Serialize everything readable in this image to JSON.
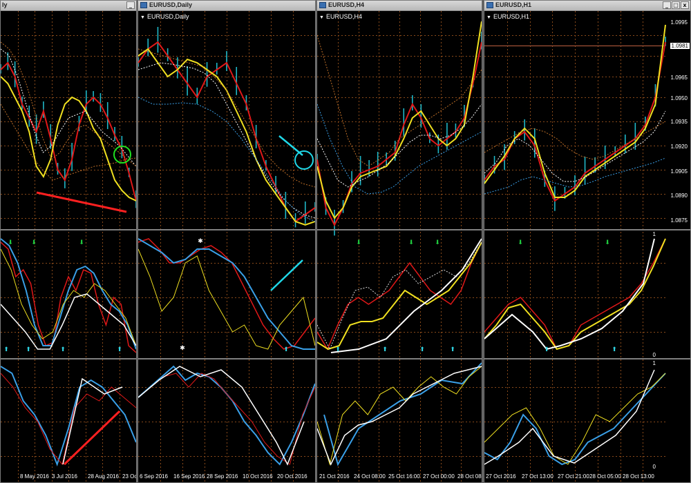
{
  "windows": [
    {
      "title": "ly",
      "symbol_label": "",
      "x_labels": [
        "8 May 2016",
        "3 Jul 2016",
        "28 Aug 2016",
        "23 Oc"
      ],
      "price_labels": [],
      "osc_labels": [],
      "osc2_labels": []
    },
    {
      "title": "EURUSD,Daily",
      "symbol_label": "EURUSD,Daily",
      "x_labels": [
        "6 Sep 2016",
        "16 Sep 2016",
        "28 Sep 2016",
        "10 Oct 2016",
        "20 Oct 2016"
      ],
      "price_labels": [],
      "osc_labels": [],
      "osc2_labels": []
    },
    {
      "title": "EURUSD,H4",
      "symbol_label": "EURUSD,H4",
      "x_labels": [
        "21 Oct 2016",
        "24 Oct 08:00",
        "25 Oct 16:00",
        "27 Oct 00:00",
        "28 Oct 08"
      ],
      "price_labels": [],
      "osc_labels": [],
      "osc2_labels": []
    },
    {
      "title": "EURUSD,H1",
      "symbol_label": "EURUSD,H1",
      "x_labels": [
        "27 Oct 2016",
        "27 Oct 13:00",
        "27 Oct 21:00",
        "28 Oct 05:00",
        "28 Oct 13:00"
      ],
      "price_labels": [
        "1.0995",
        "1.0965",
        "1.0950",
        "1.0935",
        "1.0920",
        "1.0905",
        "1.0890",
        "1.0875"
      ],
      "current_price": "1.0981",
      "osc_labels": [
        "1",
        "0"
      ],
      "osc2_labels": [
        "1",
        "0"
      ]
    }
  ],
  "window_buttons": {
    "minimize": "_",
    "maximize": "□",
    "close": "x"
  },
  "colors": {
    "background": "#000000",
    "grid": "#8a4a1a",
    "ma_red": "#e01818",
    "ma_yellow": "#f0e020",
    "ma_blue": "#3aa0e8",
    "candle": "#1fb8c8",
    "osc_white": "#ffffff",
    "marker_green": "#20d040",
    "marker_cyan": "#30d8e8",
    "annotation_red": "#ff2020",
    "annotation_cyan": "#20d8e8",
    "annotation_green": "#20e020"
  }
}
